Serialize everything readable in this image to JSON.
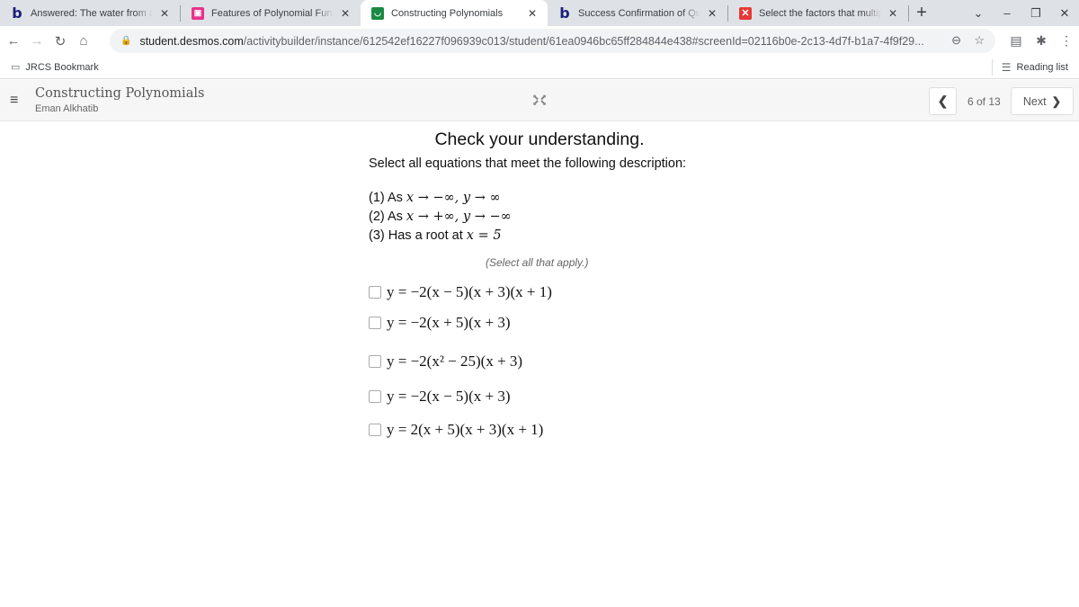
{
  "browser": {
    "tabs": [
      {
        "icon": "bartleby-icon",
        "glyph": "b",
        "title": "Answered: The water from an",
        "active": false
      },
      {
        "icon": "classroom-icon",
        "glyph": "▣",
        "title": "Features of Polynomial Functi",
        "active": false
      },
      {
        "icon": "desmos-icon",
        "glyph": "◡",
        "title": "Constructing Polynomials",
        "active": true
      },
      {
        "icon": "bartleby-icon",
        "glyph": "b",
        "title": "Success Confirmation of Ques",
        "active": false
      },
      {
        "icon": "mathway-icon",
        "glyph": "✕",
        "title": "Select the factors that multiply",
        "active": false
      }
    ],
    "tab_close_glyph": "✕",
    "new_tab_glyph": "+",
    "window_controls": {
      "dropdown": "⌄",
      "minimize": "–",
      "restore": "❐",
      "close": "✕"
    },
    "nav": {
      "back": "←",
      "forward": "→",
      "reload": "↻",
      "home": "⌂"
    },
    "url_host": "student.desmos.com",
    "url_path": "/activitybuilder/instance/612542ef16227f096939c013/student/61ea0946bc65ff284844e438#screenId=02116b0e-2c13-4d7f-b1a7-4f9f29...",
    "omnibox_icons": {
      "zoom": "⊖",
      "bookmark": "☆"
    },
    "toolbar_icons": {
      "media": "▤",
      "extensions": "✱",
      "menu": "⋮"
    },
    "bookmarks": [
      {
        "label": "JRCS Bookmark",
        "icon": "▭"
      }
    ],
    "reading_list": {
      "label": "Reading list",
      "icon": "☰"
    }
  },
  "header": {
    "menu_glyph": "≡",
    "activity_title": "Constructing Polynomials",
    "student_name": "Eman Alkhatib",
    "expand_glyph": "⤡",
    "prev_glyph": "❮",
    "page_indicator": "6 of 13",
    "next_label": "Next",
    "next_glyph": "❯"
  },
  "question": {
    "heading": "Check your understanding.",
    "instruction": "Select all equations that meet the following description:",
    "conditions": [
      {
        "prefix": "(1) As ",
        "math": "x → −∞, y → ∞"
      },
      {
        "prefix": "(2) As ",
        "math": "x → +∞, y → −∞"
      },
      {
        "prefix": "(3) Has a root at ",
        "math": "x = 5"
      }
    ],
    "select_hint": "(Select all that apply.)",
    "choices": [
      {
        "equation": "y = −2(x − 5)(x + 3)(x + 1)",
        "checked": false
      },
      {
        "equation": "y = −2(x + 5)(x + 3)",
        "checked": false
      },
      {
        "equation": "y = −2(x² − 25)(x + 3)",
        "checked": false
      },
      {
        "equation": "y = −2(x − 5)(x + 3)",
        "checked": false
      },
      {
        "equation": "y = 2(x + 5)(x + 3)(x + 1)",
        "checked": false
      }
    ]
  }
}
